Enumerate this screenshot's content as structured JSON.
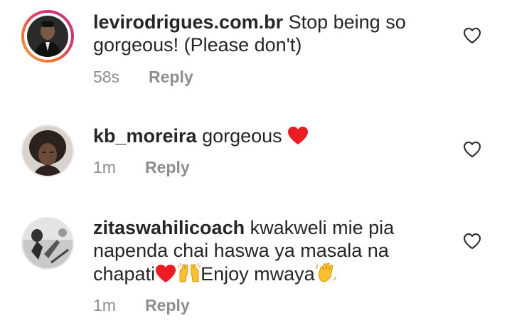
{
  "comments": [
    {
      "username": "levirodrigues.com.br",
      "text": " Stop being so",
      "text_line2": "gorgeous! (Please don't)",
      "time": "58s",
      "reply_label": "Reply",
      "has_story_ring": true
    },
    {
      "username": "kb_moreira",
      "text": " gorgeous ",
      "time": "1m",
      "reply_label": "Reply",
      "emoji": "red-heart"
    },
    {
      "username": "zitaswahilicoach",
      "text": " kwakweli mie pia",
      "text_line2": "napenda chai haswa ya masala na",
      "text_line3a": "chapati",
      "text_line3b": "Enjoy mwaya",
      "time": "1m",
      "reply_label": "Reply",
      "emojis": [
        "red-heart",
        "raising-hands",
        "waving-hand"
      ]
    }
  ],
  "colors": {
    "text": "#262626",
    "secondary": "#8e8e8e",
    "heart": "#ed1c24",
    "yellow_emoji": "#fbc02d"
  }
}
